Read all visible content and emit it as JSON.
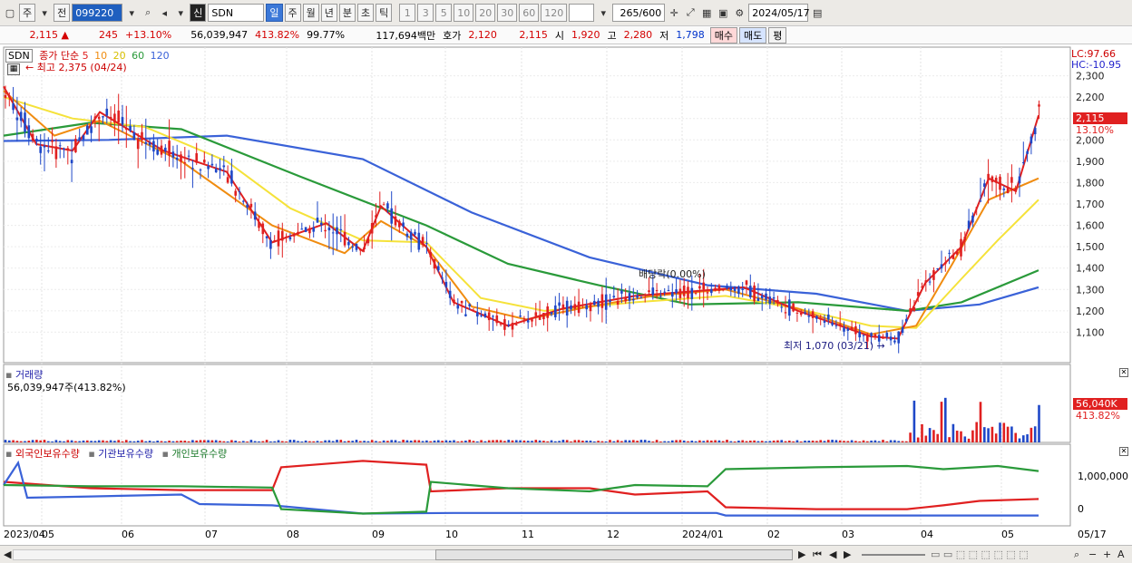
{
  "toolbar": {
    "period_type": "주",
    "prev_label": "전",
    "stock_code": "099220",
    "search_badge": "신",
    "stock_name": "SDN",
    "timeframes": [
      "일",
      "주",
      "월",
      "년",
      "분",
      "초",
      "틱"
    ],
    "active_timeframe": "일",
    "intervals": [
      "1",
      "3",
      "5",
      "10",
      "20",
      "30",
      "60",
      "120"
    ],
    "count_display": "265",
    "count_max": "/600",
    "date": "2024/05/17"
  },
  "quote": {
    "price": "2,115",
    "direction": "▲",
    "change": "245",
    "change_pct": "+13.10%",
    "volume": "56,039,947",
    "volume_ratio": "413.82%",
    "strength": "99.77%",
    "amount": "117,694백만",
    "bid_label": "호가",
    "ask_price": "2,120",
    "bid_price": "2,115",
    "open_label": "시",
    "open": "1,920",
    "high_label": "고",
    "high": "2,280",
    "low_label": "저",
    "low": "1,798",
    "buy_label": "매수",
    "sell_label": "매도",
    "eval_label": "평"
  },
  "price_panel": {
    "name": "SDN",
    "legend_title": "종가 단순",
    "ma_periods": [
      "5",
      "10",
      "20",
      "60",
      "120"
    ],
    "ma_colors": [
      "#e02020",
      "#f08c10",
      "#f5e23a",
      "#2a9a3a",
      "#3a62d8"
    ],
    "high_annotation": "← 최고 2,375 (04/24)",
    "low_annotation": "최저 1,070 (03/21) →",
    "dividend_annotation": "배당락(0.00%)",
    "lc": "LC:97.66",
    "hc": "HC:-10.95",
    "current_price_tag": "2,115",
    "current_pct_tag": "13.10%",
    "y_ticks": [
      "2,300",
      "2,200",
      "2,100",
      "2,000",
      "1,900",
      "1,800",
      "1,700",
      "1,600",
      "1,500",
      "1,400",
      "1,300",
      "1,200",
      "1,100"
    ]
  },
  "volume_panel": {
    "title": "거래량",
    "value": "56,039,947주(413.82%)",
    "tag_value": "56,040K",
    "tag_pct": "413.82%"
  },
  "holdings_panel": {
    "series": [
      "외국인보유수량",
      "기관보유수량",
      "개인보유수량"
    ],
    "series_colors": [
      "#e02020",
      "#3a62d8",
      "#2a9a3a"
    ],
    "y_ticks": [
      "1,000,000",
      "0"
    ]
  },
  "x_axis": {
    "labels": [
      "2023/04",
      "05",
      "06",
      "07",
      "08",
      "09",
      "10",
      "11",
      "12",
      "2024/01",
      "02",
      "03",
      "04",
      "05"
    ],
    "last_date": "05/17"
  },
  "scroll": {
    "controls": [
      "▶",
      "⏮",
      "◀",
      "▶"
    ],
    "zoom_out": "−",
    "zoom_in": "+",
    "auto": "A"
  }
}
